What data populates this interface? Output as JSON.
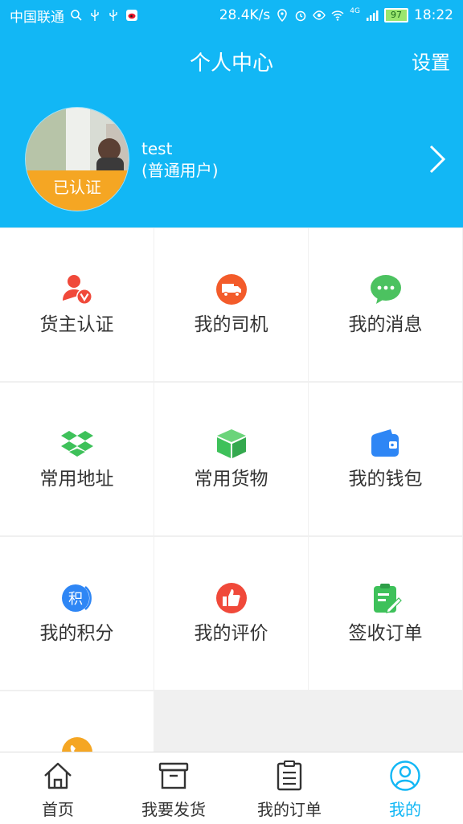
{
  "status_bar": {
    "carrier": "中国联通",
    "speed": "28.4K/s",
    "network": "4G",
    "battery": "97",
    "time": "18:22"
  },
  "header": {
    "title": "个人中心",
    "settings_label": "设置"
  },
  "profile": {
    "username": "test",
    "user_type": "(普通用户)",
    "verified_badge": "已认证"
  },
  "menu": [
    {
      "label": "货主认证",
      "icon": "shipper-verify-icon",
      "color": "#f0493a"
    },
    {
      "label": "我的司机",
      "icon": "truck-icon",
      "color": "#f35b2a"
    },
    {
      "label": "我的消息",
      "icon": "message-bubble-icon",
      "color": "#4cc260"
    },
    {
      "label": "常用地址",
      "icon": "address-boxes-icon",
      "color": "#3ec15a"
    },
    {
      "label": "常用货物",
      "icon": "cargo-box-icon",
      "color": "#3ec15a"
    },
    {
      "label": "我的钱包",
      "icon": "wallet-icon",
      "color": "#2e86f5"
    },
    {
      "label": "我的积分",
      "icon": "points-icon",
      "color": "#2e86f5"
    },
    {
      "label": "我的评价",
      "icon": "thumbs-up-icon",
      "color": "#f0493a"
    },
    {
      "label": "签收订单",
      "icon": "clipboard-sign-icon",
      "color": "#3ec15a"
    },
    {
      "label": "",
      "icon": "phone-icon",
      "color": "#f5a623"
    }
  ],
  "tabs": [
    {
      "label": "首页",
      "icon": "home-icon",
      "active": false
    },
    {
      "label": "我要发货",
      "icon": "box-icon",
      "active": false
    },
    {
      "label": "我的订单",
      "icon": "order-list-icon",
      "active": false
    },
    {
      "label": "我的",
      "icon": "user-icon",
      "active": true
    }
  ],
  "colors": {
    "accent": "#12b7f5",
    "badge": "#f5a623"
  }
}
